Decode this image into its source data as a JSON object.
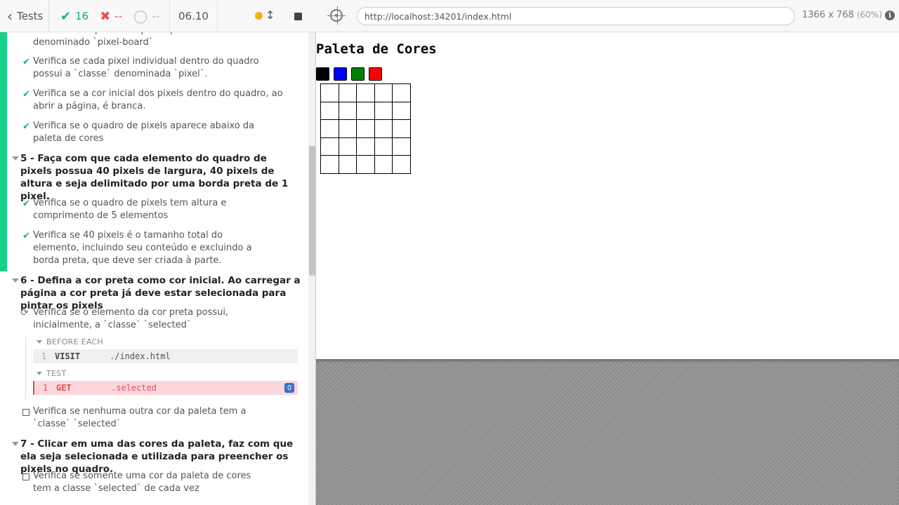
{
  "reporter": {
    "header": {
      "tests_label": "Tests",
      "passed": "16",
      "failed": "--",
      "pending": "--",
      "duration": "06.10",
      "back_icon": "chevron-left-icon",
      "pass_icon": "check-icon",
      "fail_icon": "x-icon",
      "pending_icon": "circle-icon"
    },
    "tests": [
      {
        "text": "Verifica se o quadro de pixels possui o `id` denominado `pixel-board`",
        "state": "passed"
      },
      {
        "text": "Verifica se cada pixel individual dentro do quadro possui a `classe` denominada `pixel`.",
        "state": "passed"
      },
      {
        "text": "Verifica se a cor inicial dos pixels dentro do quadro, ao abrir a página, é branca.",
        "state": "passed"
      },
      {
        "text": "Verifica se o quadro de pixels aparece abaixo da paleta de cores",
        "state": "passed"
      }
    ],
    "suite5": {
      "title": "5 - Faça com que cada elemento do quadro de pixels possua 40 pixels de largura, 40 pixels de altura e seja delimitado por uma borda preta de 1 pixel.",
      "tests": [
        {
          "text": "Verifica se o quadro de pixels tem altura e comprimento de 5 elementos",
          "state": "passed"
        },
        {
          "text": "Verifica se 40 pixels é o tamanho total do elemento, incluindo seu conteúdo e excluindo a borda preta, que deve ser criada à parte.",
          "state": "passed"
        }
      ]
    },
    "suite6": {
      "title": "6 - Defina a cor preta como cor inicial. Ao carregar a página a cor preta já deve estar selecionada para pintar os pixels",
      "running_test": "Verifica se o elemento da cor preta possui, inicialmente, a `classe` `selected`",
      "before_each_label": "BEFORE EACH",
      "test_label": "TEST",
      "visit": {
        "num": "1",
        "name": "VISIT",
        "msg": "./index.html"
      },
      "get": {
        "num": "1",
        "name": "GET",
        "msg": ".selected",
        "count": "0"
      },
      "pending_test": "Verifica se nenhuma outra cor da paleta tem a `classe` `selected`"
    },
    "suite7": {
      "title": "7 - Clicar em uma das cores da paleta, faz com que ela seja selecionada e utilizada para preencher os pixels no quadro.",
      "pending_test": "Verifica se somente uma cor da paleta de cores tem a classe `selected` de cada vez"
    }
  },
  "aut": {
    "url": "http://localhost:34201/index.html",
    "viewport": "1366 x 768",
    "scale": "(60%)",
    "page": {
      "title": "Paleta de Cores",
      "palette_colors": [
        "#000000",
        "#0000ff",
        "#008000",
        "#ff0000"
      ],
      "board_rows": 5,
      "board_cols": 5
    }
  }
}
